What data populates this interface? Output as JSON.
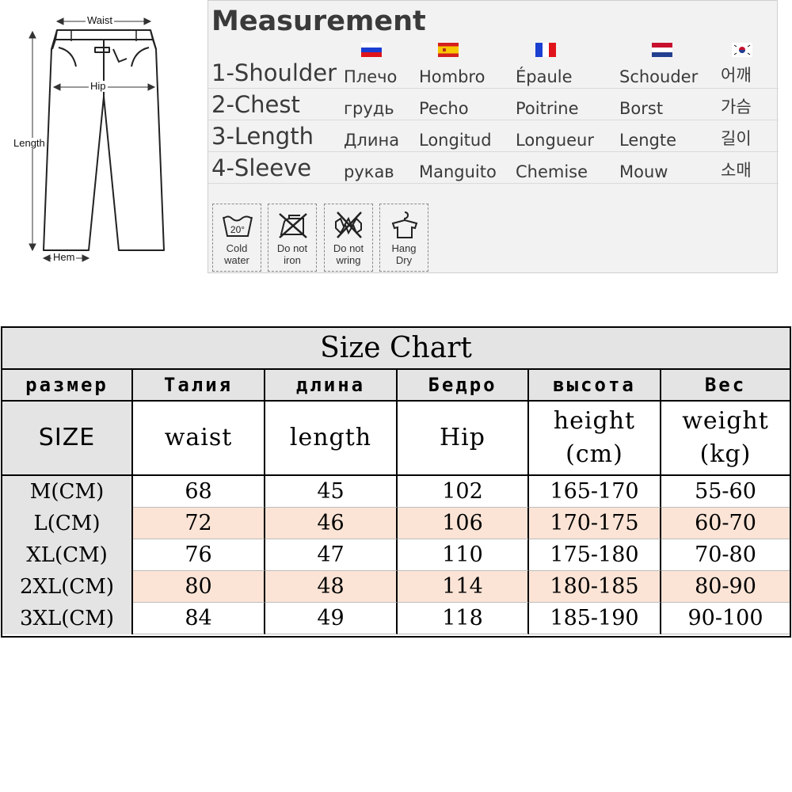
{
  "diagram": {
    "labels": {
      "waist": "Waist",
      "hip": "Hip",
      "length": "Length",
      "hem": "Hem"
    }
  },
  "measurement": {
    "title": "Measurement",
    "flags": [
      "russia-flag",
      "spain-flag",
      "france-flag",
      "netherlands-flag",
      "korea-flag"
    ],
    "rows": [
      {
        "label": "1-Shoulder",
        "ru": "Плечо",
        "es": "Hombro",
        "fr": "Épaule",
        "nl": "Schouder",
        "ko": "어깨"
      },
      {
        "label": "2-Chest",
        "ru": "грудь",
        "es": "Pecho",
        "fr": "Poitrine",
        "nl": "Borst",
        "ko": "가슴"
      },
      {
        "label": "3-Length",
        "ru": "Длина",
        "es": "Longitud",
        "fr": "Longueur",
        "nl": "Lengte",
        "ko": "길이"
      },
      {
        "label": "4-Sleeve",
        "ru": "рукав",
        "es": "Manguito",
        "fr": "Chemise",
        "nl": "Mouw",
        "ko": "소매"
      }
    ],
    "care": [
      {
        "icon": "cold-wash-icon",
        "line1": "Cold",
        "line2": "water",
        "temp": "20°"
      },
      {
        "icon": "do-not-iron-icon",
        "line1": "Do not",
        "line2": "iron"
      },
      {
        "icon": "do-not-wring-icon",
        "line1": "Do not",
        "line2": "wring"
      },
      {
        "icon": "hang-dry-icon",
        "line1": "Hang",
        "line2": "Dry"
      }
    ]
  },
  "size_chart": {
    "title": "Size Chart",
    "ru_headers": [
      "размер",
      "Талия",
      "длина",
      "Бедро",
      "высота",
      "Вес"
    ],
    "en_headers": [
      {
        "line1": "SIZE",
        "line2": ""
      },
      {
        "line1": "waist",
        "line2": ""
      },
      {
        "line1": "length",
        "line2": ""
      },
      {
        "line1": "Hip",
        "line2": ""
      },
      {
        "line1": "height",
        "line2": "(cm)"
      },
      {
        "line1": "weight",
        "line2": "(kg)"
      }
    ],
    "rows": [
      {
        "size": "M(CM)",
        "cells": [
          "68",
          "45",
          "102",
          "165-170",
          "55-60"
        ]
      },
      {
        "size": "L(CM)",
        "cells": [
          "72",
          "46",
          "106",
          "170-175",
          "60-70"
        ]
      },
      {
        "size": "XL(CM)",
        "cells": [
          "76",
          "47",
          "110",
          "175-180",
          "70-80"
        ]
      },
      {
        "size": "2XL(CM)",
        "cells": [
          "80",
          "48",
          "114",
          "180-185",
          "80-90"
        ]
      },
      {
        "size": "3XL(CM)",
        "cells": [
          "84",
          "49",
          "118",
          "185-190",
          "90-100"
        ]
      }
    ],
    "colors": {
      "header_gray": "#e4e4e4",
      "row_pink": "#fbe4d6"
    }
  }
}
